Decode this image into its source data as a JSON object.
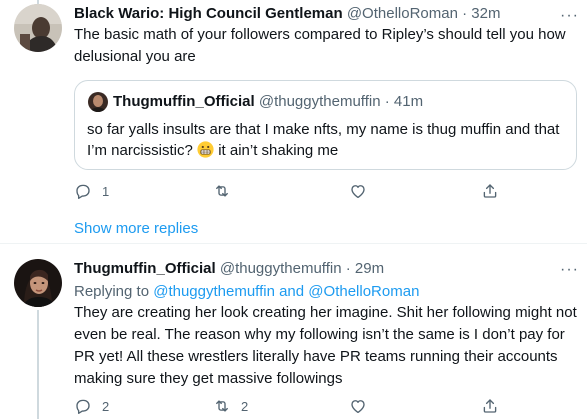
{
  "tweets": [
    {
      "author_name": "Black Wario: High Council Gentleman",
      "handle": "@OthelloRoman",
      "time": "32m",
      "text": "The basic math of your followers compared to Ripley’s should tell you how delusional you are",
      "quote": {
        "author_name": "Thugmuffin_Official",
        "handle": "@thuggythemuffin",
        "time": "41m",
        "text_before_emoji": "so far yalls insults are that I make nfts, my name is thug muffin and that I’m narcissistic?",
        "emoji": "grimacing-face",
        "text_after_emoji": "it ain’t shaking me"
      },
      "actions": {
        "reply_count": "1",
        "retweet_count": "",
        "like_count": ""
      }
    },
    {
      "author_name": "Thugmuffin_Official",
      "handle": "@thuggythemuffin",
      "time": "29m",
      "replying_prefix": "Replying to",
      "replying_to_1": "@thuggythemuffin",
      "replying_and": "and",
      "replying_to_2": "@OthelloRoman",
      "text": "They are creating her look creating her imagine. Shit her following might not even be real. The reason why my following isn’t the same is I don’t pay for PR yet! All these wrestlers literally have PR teams running their accounts making sure they get massive followings",
      "actions": {
        "reply_count": "2",
        "retweet_count": "2",
        "like_count": ""
      }
    }
  ],
  "show_more_replies": "Show more replies",
  "dot": "·",
  "more_icon": "···",
  "colors": {
    "link": "#1d9bf0",
    "secondary": "#536471",
    "border": "#cfd9de"
  }
}
